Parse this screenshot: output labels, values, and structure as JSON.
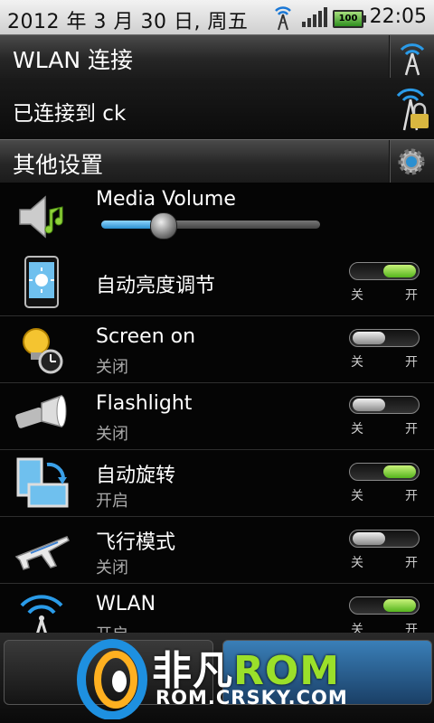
{
  "status_bar": {
    "date": "2012 年 3 月 30 日, 周五",
    "time": "22:05",
    "battery": "100"
  },
  "wlan_header": {
    "title": "WLAN 连接",
    "icon": "wifi-tower-icon"
  },
  "wlan_connection": {
    "status": "已连接到 ck",
    "icon": "wifi-lock-icon"
  },
  "other_header": {
    "title": "其他设置",
    "icon": "gear-icon"
  },
  "media_volume": {
    "label": "Media Volume",
    "level": 0.28,
    "icon": "speaker-music-icon"
  },
  "toggle_labels": {
    "off": "关",
    "on": "开"
  },
  "settings": [
    {
      "title": "自动亮度调节",
      "subtitle": "",
      "state": "on",
      "icon": "auto-brightness-icon"
    },
    {
      "title": "Screen on",
      "subtitle": "关闭",
      "state": "off",
      "icon": "bulb-clock-icon"
    },
    {
      "title": "Flashlight",
      "subtitle": "关闭",
      "state": "off",
      "icon": "flashlight-icon"
    },
    {
      "title": "自动旋转",
      "subtitle": "开启",
      "state": "on",
      "icon": "auto-rotate-icon"
    },
    {
      "title": "飞行模式",
      "subtitle": "关闭",
      "state": "off",
      "icon": "airplane-icon"
    },
    {
      "title": "WLAN",
      "subtitle": "开启",
      "state": "on",
      "icon": "wifi-icon"
    }
  ],
  "watermark": {
    "brand_cn": "非凡",
    "brand_rom": "ROM",
    "url": "ROM.CRSKY.COM"
  },
  "colors": {
    "accent_green": "#55b51d",
    "accent_blue": "#2a8fd0"
  }
}
